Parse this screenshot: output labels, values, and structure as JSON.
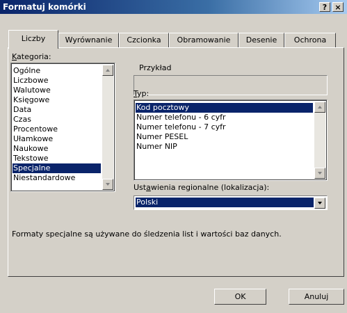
{
  "window": {
    "title": "Formatuj komórki",
    "help_label": "?",
    "close_label": "×"
  },
  "tabs": [
    {
      "label": "Liczby",
      "active": true
    },
    {
      "label": "Wyrównanie",
      "active": false
    },
    {
      "label": "Czcionka",
      "active": false
    },
    {
      "label": "Obramowanie",
      "active": false
    },
    {
      "label": "Desenie",
      "active": false
    },
    {
      "label": "Ochrona",
      "active": false
    }
  ],
  "category": {
    "label": "Kategoria:",
    "label_accel": "K",
    "label_rest": "ategoria:",
    "items": [
      "Ogólne",
      "Liczbowe",
      "Walutowe",
      "Księgowe",
      "Data",
      "Czas",
      "Procentowe",
      "Ułamkowe",
      "Naukowe",
      "Tekstowe",
      "Specjalne",
      "Niestandardowe"
    ],
    "selected": "Specjalne"
  },
  "sample": {
    "label": "Przykład",
    "value": ""
  },
  "type": {
    "label": "Typ:",
    "label_accel": "T",
    "label_rest": "yp:",
    "items": [
      "Kod pocztowy",
      "Numer telefonu - 6 cyfr",
      "Numer telefonu - 7 cyfr",
      "Numer PESEL",
      "Numer NIP"
    ],
    "selected": "Kod pocztowy"
  },
  "region": {
    "label": "Ustawienia regionalne (lokalizacja):",
    "label_pre": "Ust",
    "label_accel": "a",
    "label_rest": "wienia regionalne (lokalizacja):",
    "value": "Polski"
  },
  "description": "Formaty specjalne są używane do śledzenia list i wartości baz danych.",
  "buttons": {
    "ok": "OK",
    "cancel": "Anuluj"
  },
  "colors": {
    "selection": "#0a246a",
    "face": "#d4d0c8",
    "title_gradient_start": "#0a246a"
  }
}
